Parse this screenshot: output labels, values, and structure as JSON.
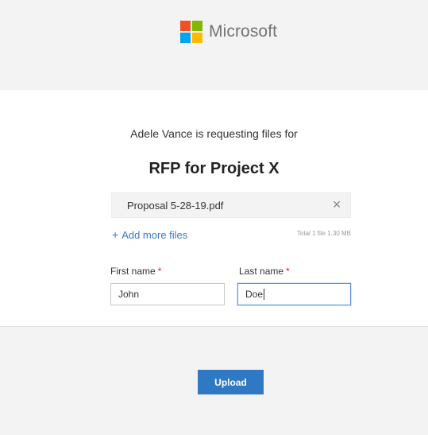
{
  "header": {
    "logo_text": "Microsoft",
    "logo_colors": [
      "#f25022",
      "#7fba00",
      "#00a4ef",
      "#ffb900"
    ]
  },
  "request": {
    "text": "Adele Vance is requesting files for",
    "project_title": "RFP for Project X"
  },
  "files": {
    "items": [
      {
        "name": "Proposal 5-28-19.pdf",
        "remove_icon": "close-icon"
      }
    ],
    "add_more_label": "Add more files",
    "total_info": "Total 1 file  1.30 MB"
  },
  "form": {
    "first_name": {
      "label": "First name",
      "required_mark": "*",
      "value": "John"
    },
    "last_name": {
      "label": "Last name",
      "required_mark": "*",
      "value": "Doe"
    }
  },
  "footer": {
    "upload_label": "Upload"
  },
  "colors": {
    "accent": "#2f78c4",
    "link": "#3a78c6",
    "required": "#c4262e",
    "header_bg": "#f3f3f3"
  }
}
